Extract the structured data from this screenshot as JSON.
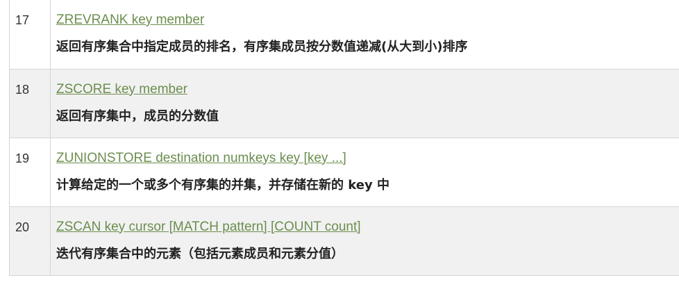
{
  "rows": [
    {
      "number": "17",
      "command": "ZREVRANK key member",
      "description": "返回有序集合中指定成员的排名，有序集成员按分数值递减(从大到小)排序"
    },
    {
      "number": "18",
      "command": "ZSCORE key member",
      "description": "返回有序集中，成员的分数值"
    },
    {
      "number": "19",
      "command": "ZUNIONSTORE destination numkeys key [key ...]",
      "description": "计算给定的一个或多个有序集的并集，并存储在新的 key 中"
    },
    {
      "number": "20",
      "command": "ZSCAN key cursor [MATCH pattern] [COUNT count]",
      "description": "迭代有序集合中的元素（包括元素成员和元素分值）"
    }
  ],
  "colors": {
    "link": "#6b8e4e",
    "row_alt_background": "#f1f1f1",
    "border": "#d4d4d4"
  }
}
